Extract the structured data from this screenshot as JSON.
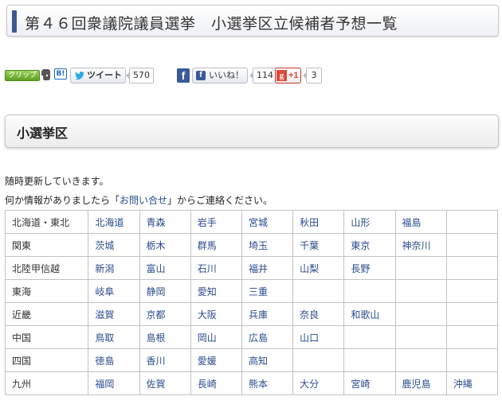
{
  "page_title": "第４６回衆議院議員選挙　小選挙区立候補者予想一覧",
  "social": {
    "clip_label": "クリップ",
    "hatena_label": "B!",
    "tweet_label": "ツイート",
    "tweet_count": "570",
    "facebook_letter": "f",
    "like_label": "いいね！",
    "like_count": "114",
    "gplus_label": "+1",
    "gplus_count": "3"
  },
  "section": {
    "heading": "小選挙区"
  },
  "notice": {
    "line1": "随時更新していきます。",
    "line2_prefix": "何か情報がありましたら「",
    "line2_link": "お問い合せ",
    "line2_suffix": "」からご連絡ください。"
  },
  "regions": [
    {
      "name": "北海道・東北",
      "prefs": [
        "北海道",
        "青森",
        "岩手",
        "宮城",
        "秋田",
        "山形",
        "福島",
        ""
      ]
    },
    {
      "name": "関東",
      "prefs": [
        "茨城",
        "栃木",
        "群馬",
        "埼玉",
        "千葉",
        "東京",
        "神奈川",
        ""
      ]
    },
    {
      "name": "北陸甲信越",
      "prefs": [
        "新潟",
        "富山",
        "石川",
        "福井",
        "山梨",
        "長野",
        "",
        ""
      ]
    },
    {
      "name": "東海",
      "prefs": [
        "岐阜",
        "静岡",
        "愛知",
        "三重",
        "",
        "",
        "",
        ""
      ]
    },
    {
      "name": "近畿",
      "prefs": [
        "滋賀",
        "京都",
        "大阪",
        "兵庫",
        "奈良",
        "和歌山",
        "",
        ""
      ]
    },
    {
      "name": "中国",
      "prefs": [
        "鳥取",
        "島根",
        "岡山",
        "広島",
        "山口",
        "",
        "",
        ""
      ]
    },
    {
      "name": "四国",
      "prefs": [
        "徳島",
        "香川",
        "愛媛",
        "高知",
        "",
        "",
        "",
        ""
      ]
    },
    {
      "name": "九州",
      "prefs": [
        "福岡",
        "佐賀",
        "長崎",
        "熊本",
        "大分",
        "宮崎",
        "鹿児島",
        "沖縄"
      ]
    }
  ],
  "colors": {
    "link": "#2a4b8d",
    "title_bar": "#3f5a93",
    "facebook": "#3b5998",
    "gplus": "#db4a39",
    "clip": "#5fa022"
  }
}
